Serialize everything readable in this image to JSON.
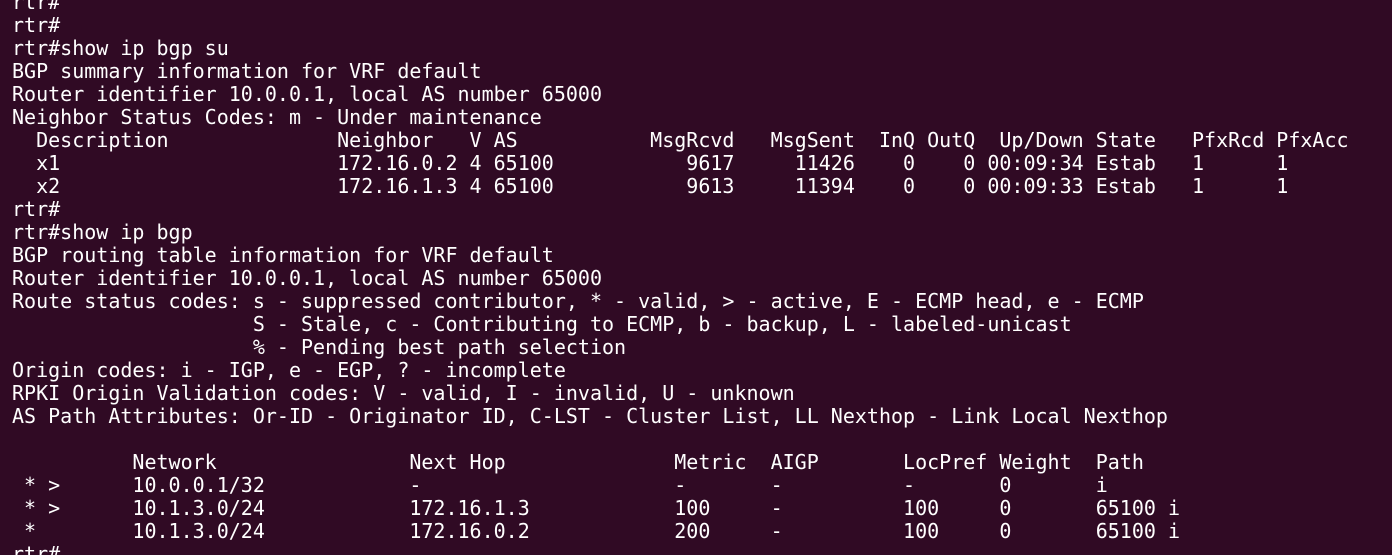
{
  "terminal": {
    "background": "#300a24",
    "foreground": "#ffffff",
    "lines": [
      "rtr#",
      "rtr#",
      "rtr#show ip bgp su",
      "BGP summary information for VRF default",
      "Router identifier 10.0.0.1, local AS number 65000",
      "Neighbor Status Codes: m - Under maintenance",
      "  Description              Neighbor   V AS           MsgRcvd   MsgSent  InQ OutQ  Up/Down State   PfxRcd PfxAcc",
      "  x1                       172.16.0.2 4 65100           9617     11426    0    0 00:09:34 Estab   1      1",
      "  x2                       172.16.1.3 4 65100           9613     11394    0    0 00:09:33 Estab   1      1",
      "rtr#",
      "rtr#show ip bgp",
      "BGP routing table information for VRF default",
      "Router identifier 10.0.0.1, local AS number 65000",
      "Route status codes: s - suppressed contributor, * - valid, > - active, E - ECMP head, e - ECMP",
      "                    S - Stale, c - Contributing to ECMP, b - backup, L - labeled-unicast",
      "                    % - Pending best path selection",
      "Origin codes: i - IGP, e - EGP, ? - incomplete",
      "RPKI Origin Validation codes: V - valid, I - invalid, U - unknown",
      "AS Path Attributes: Or-ID - Originator ID, C-LST - Cluster List, LL Nexthop - Link Local Nexthop",
      "",
      "          Network                Next Hop              Metric  AIGP       LocPref Weight  Path",
      " * >      10.0.0.1/32            -                     -       -          -       0       i",
      " * >      10.1.3.0/24            172.16.1.3            100     -          100     0       65100 i",
      " *        10.1.3.0/24            172.16.0.2            200     -          100     0       65100 i",
      "rtr#"
    ]
  }
}
